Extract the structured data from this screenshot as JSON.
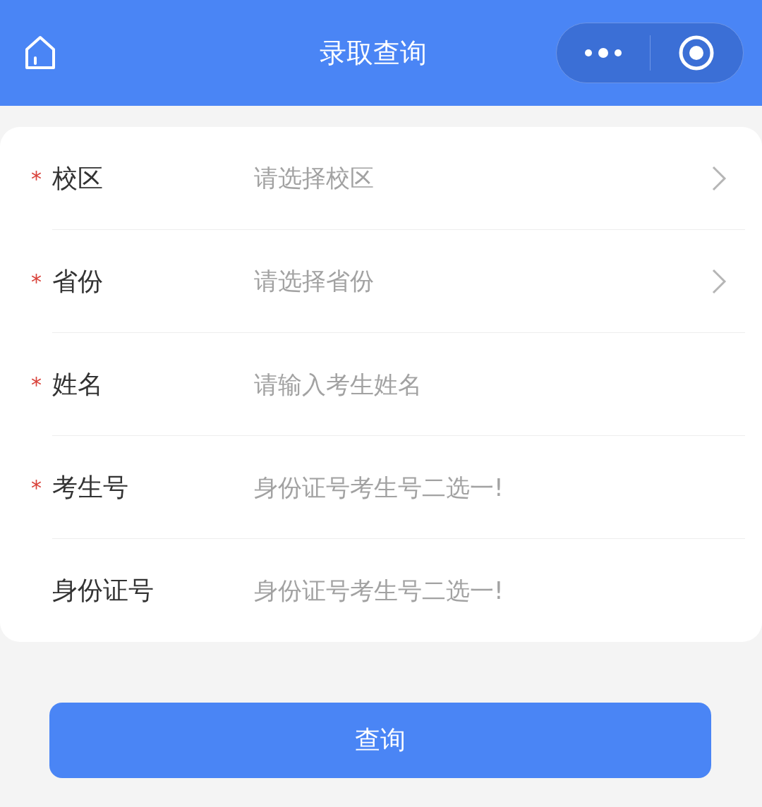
{
  "header": {
    "title": "录取查询"
  },
  "fields": [
    {
      "kind": "select",
      "required_mark": "*",
      "label": "校区",
      "placeholder": "请选择校区"
    },
    {
      "kind": "select",
      "required_mark": "*",
      "label": "省份",
      "placeholder": "请选择省份"
    },
    {
      "kind": "input",
      "required_mark": "*",
      "label": "姓名",
      "placeholder": "请输入考生姓名"
    },
    {
      "kind": "input",
      "required_mark": "*",
      "label": "考生号",
      "placeholder": "身份证号考生号二选一!"
    },
    {
      "kind": "input",
      "label": "身份证号",
      "placeholder": "身份证号考生号二选一!"
    }
  ],
  "submit_button": {
    "label": "查询"
  }
}
